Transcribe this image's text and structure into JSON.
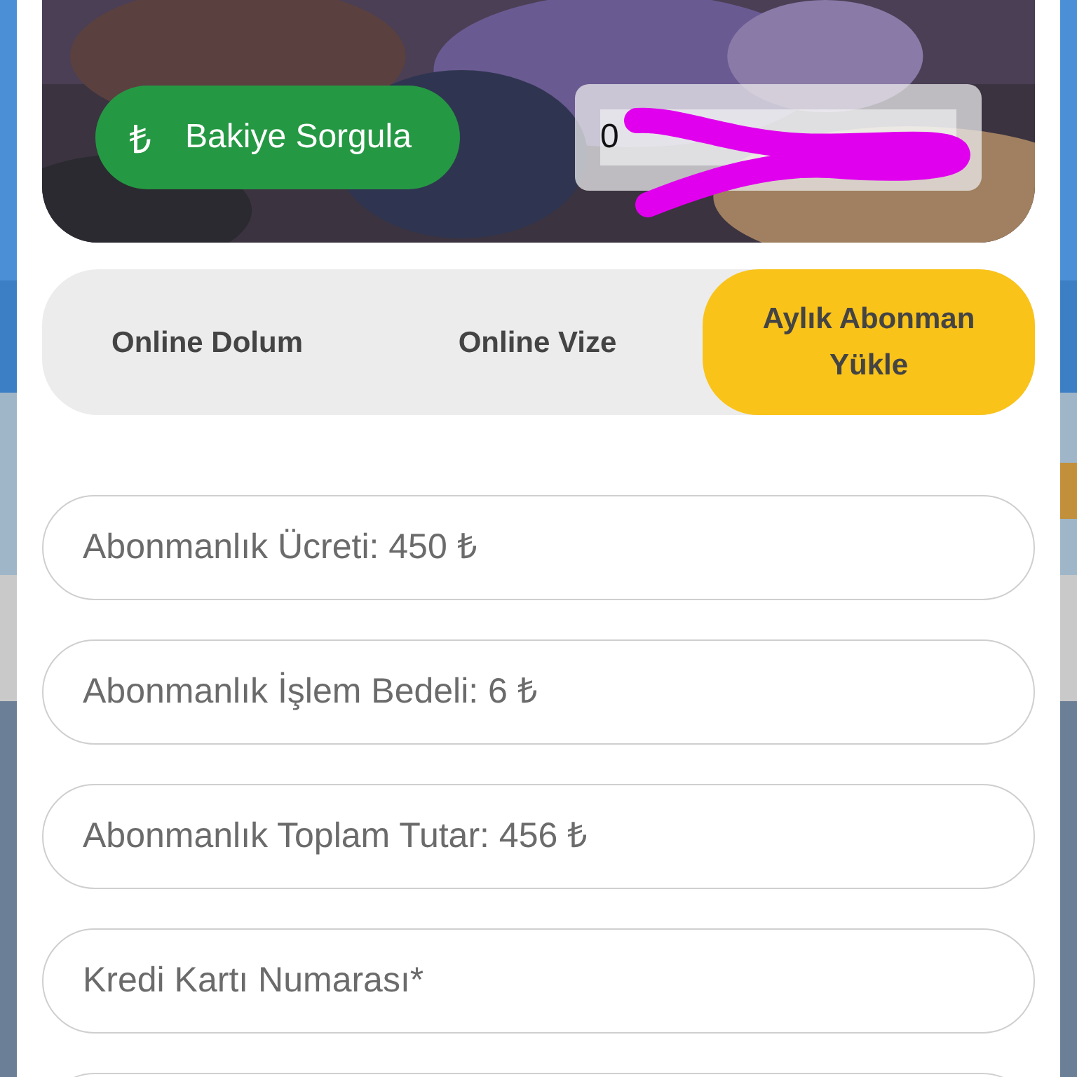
{
  "header": {
    "kind": "picture",
    "balance_button": {
      "icon": "₺",
      "label": "Bakiye Sorgula"
    },
    "card_field": {
      "value": "0",
      "redacted": true
    }
  },
  "tabs": [
    {
      "label": "Online Dolum",
      "selected": false
    },
    {
      "label": "Online Vize",
      "selected": false
    },
    {
      "label": "Aylık Abonman Yükle",
      "selected": true
    }
  ],
  "form_fields": [
    {
      "placeholder": "Abonmanlık Ücreti: 450 ₺"
    },
    {
      "placeholder": "Abonmanlık İşlem Bedeli: 6 ₺"
    },
    {
      "placeholder": "Abonmanlık Toplam Tutar: 456 ₺"
    },
    {
      "placeholder": "Kredi Kartı Numarası*"
    }
  ]
}
